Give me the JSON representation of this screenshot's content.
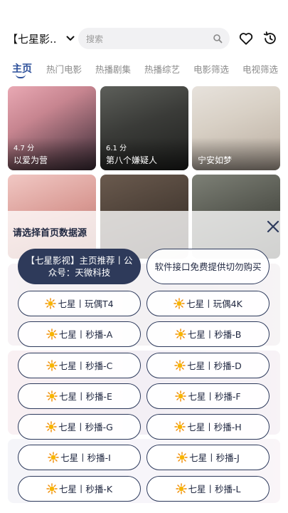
{
  "header": {
    "source_label": "【七星影..",
    "search_placeholder": "搜索"
  },
  "tabs": [
    "主页",
    "热门电影",
    "热播剧集",
    "热播综艺",
    "电影筛选",
    "电视筛选"
  ],
  "cards": [
    {
      "rating": "4.7 分",
      "title": "以爱为营"
    },
    {
      "rating": "6.1 分",
      "title": "第八个嫌疑人"
    },
    {
      "rating": "",
      "title": "宁安如梦"
    }
  ],
  "sheet": {
    "title": "请选择首页数据源",
    "options": [
      "【七星影视】主页推荐丨公众号：天微科技",
      "软件接口免费提供切勿购买",
      "七星丨玩偶T4",
      "七星丨玩偶4K",
      "七星丨秒播-A",
      "七星丨秒播-B",
      "七星丨秒播-C",
      "七星丨秒播-D",
      "七星丨秒播-E",
      "七星丨秒播-F",
      "七星丨秒播-G",
      "七星丨秒播-H",
      "七星丨秒播-I",
      "七星丨秒播-J",
      "七星丨秒播-K",
      "七星丨秒播-L"
    ]
  },
  "colors": {
    "accent": "#2c4f9a",
    "selected_option": "#2e3a5a",
    "option_border": "#2d3a5c"
  },
  "icons": [
    "chevron-down-icon",
    "search-icon",
    "heart-icon",
    "history-icon",
    "close-icon",
    "sun-icon"
  ]
}
